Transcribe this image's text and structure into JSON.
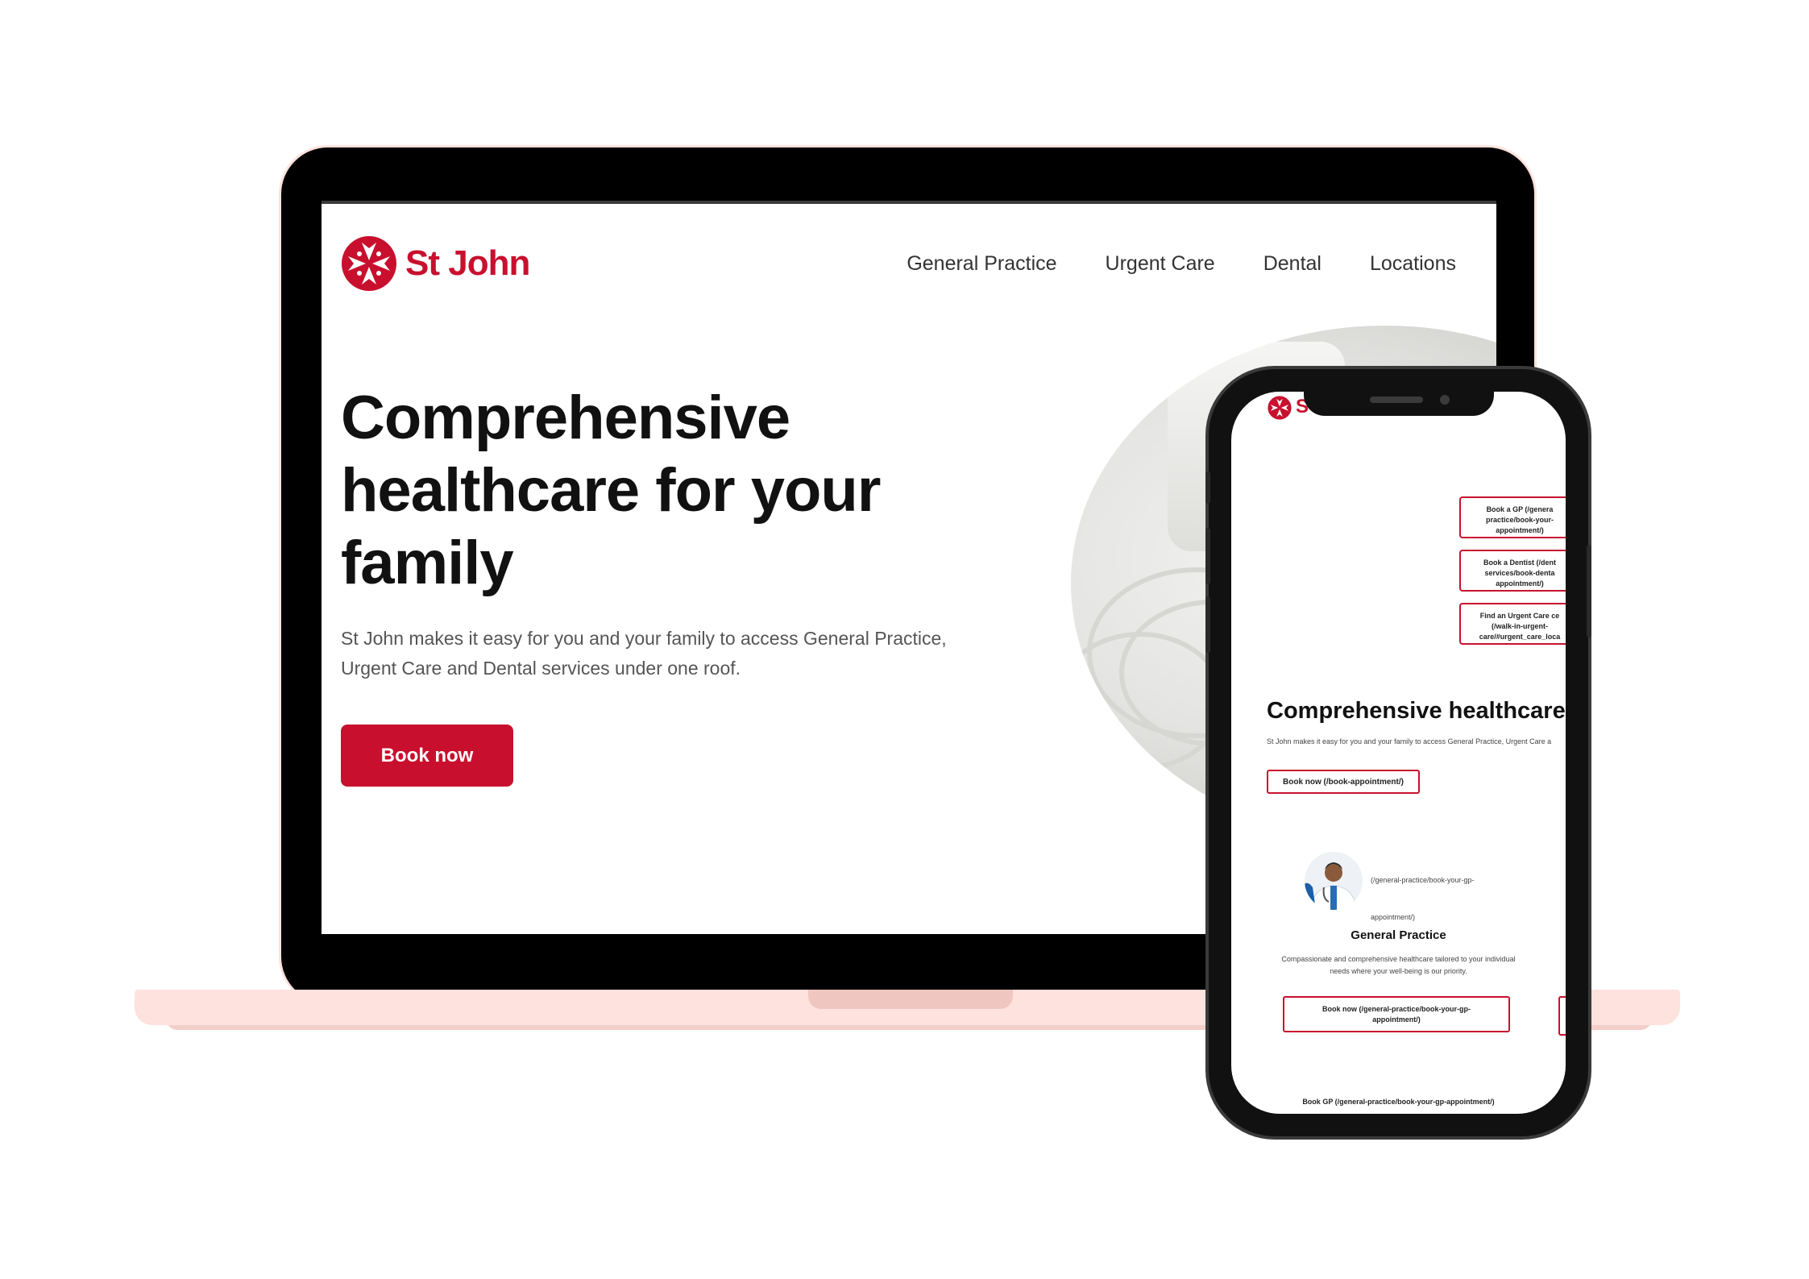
{
  "brand": {
    "name": "St John",
    "accent": "#c8102e",
    "device_pink": "#fde2dd"
  },
  "nav": {
    "items": [
      "General Practice",
      "Urgent Care",
      "Dental",
      "Locations"
    ]
  },
  "hero": {
    "title": "Comprehensive healthcare for your family",
    "copy": "St John makes it easy for you and your family to access General Practice, Urgent Care and Dental services under one roof.",
    "cta": "Book now"
  },
  "mobile": {
    "logo_partial": "S",
    "quick_links": [
      "Book a GP (/genera\npractice/book-your-\nappointment/)",
      "Book a Dentist (/dent\nservices/book-denta\nappointment/)",
      "Find an Urgent Care ce\n(/walk-in-urgent-\ncare/#urgent_care_loca"
    ],
    "title": "Comprehensive healthcare",
    "copy": "St John makes it easy for you and your family to access General Practice, Urgent Care a",
    "cta": "Book now (/book-appointment/)",
    "gp_card": {
      "image_link_a": "(/general-practice/book-your-gp-",
      "image_link_b": "appointment/)",
      "title": "General Practice",
      "description": "Compassionate and comprehensive healthcare tailored to your individual needs where your well-being is our priority.",
      "cta": "Book now (/general-practice/book-your-gp-appointment/)"
    },
    "footer_link": "Book GP (/general-practice/book-your-gp-appointment/)"
  }
}
